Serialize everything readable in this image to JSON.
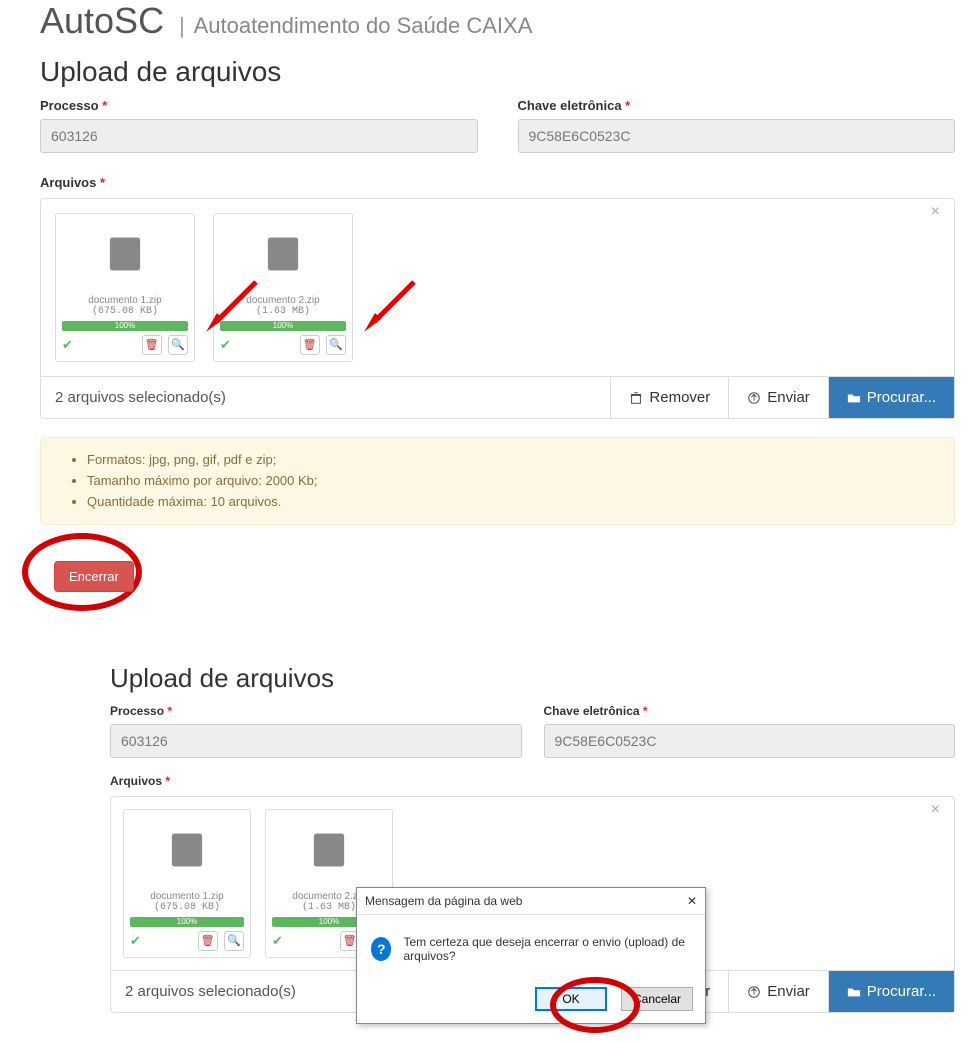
{
  "app": {
    "brand": "AutoSC",
    "separator": "|",
    "subtitle": "Autoatendimento do Saúde CAIXA"
  },
  "page_title": "Upload de arquivos",
  "labels": {
    "processo": "Processo",
    "chave": "Chave eletrônica",
    "arquivos": "Arquivos",
    "required_mark": "*"
  },
  "fields": {
    "processo": "603126",
    "chave": "9C58E6C0523C"
  },
  "files": [
    {
      "name": "documento 1.zip",
      "size": "(675.08 KB)",
      "progress": "100%"
    },
    {
      "name": "documento 2.zip",
      "size": "(1.63 MB)",
      "progress": "100%"
    }
  ],
  "panel_footer": {
    "status": "2 arquivos selecionado(s)",
    "remover": "Remover",
    "enviar": "Enviar",
    "procurar": "Procurar..."
  },
  "info_lines": [
    "Formatos: jpg, png, gif, pdf e zip;",
    "Tamanho máximo por arquivo: 2000 Kb;",
    "Quantidade máxima: 10 arquivos."
  ],
  "encerrar_label": "Encerrar",
  "dialog": {
    "title": "Mensagem da página da web",
    "message": "Tem certeza que deseja encerrar o envio (upload) de arquivos?",
    "ok": "OK",
    "cancel": "Cancelar",
    "close_glyph": "✕"
  },
  "glyphs": {
    "close_x": "×",
    "check": "✔",
    "trash": "🗑",
    "zoom": "🔍",
    "upload": "⬆",
    "folder": "📂"
  }
}
